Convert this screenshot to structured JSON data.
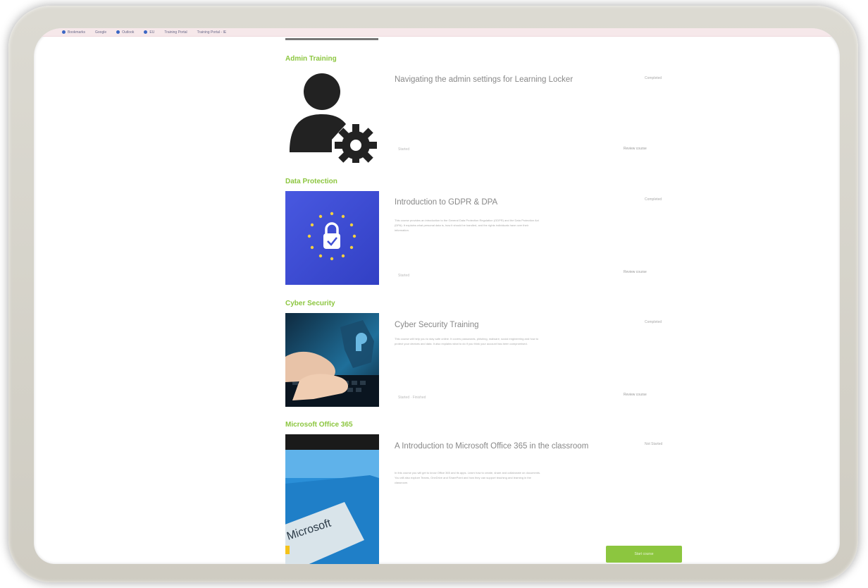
{
  "bookmarks": [
    "Bookmarks",
    "Google",
    "Outlook",
    "EU",
    "Training Portal",
    "Training Portal - IE"
  ],
  "sections": [
    {
      "category": "Admin Training",
      "course_title": "Navigating the admin settings for Learning Locker",
      "status": "Completed",
      "description": "",
      "meta": "Started",
      "action": "Review course",
      "thumb_icon": "user-gear-icon"
    },
    {
      "category": "Data Protection",
      "course_title": "Introduction to GDPR & DPA",
      "status": "Completed",
      "description": "This course provides an introduction to the General Data Protection Regulation (GDPR) and the Data Protection Act (DPA). It explains what personal data is, how it should be handled, and the rights individuals have over their information.",
      "meta": "Started",
      "action": "Review course",
      "thumb_icon": "eu-lock-icon",
      "thumb_color": "#3f4fd4"
    },
    {
      "category": "Cyber Security",
      "course_title": "Cyber Security Training",
      "status": "Completed",
      "description": "This course will help you to stay safe online. It covers passwords, phishing, malware, social engineering and how to protect your devices and data. It also explains what to do if you think your account has been compromised.",
      "meta": "Started · Finished",
      "action": "Review course",
      "thumb_icon": "hands-keyboard-icon"
    },
    {
      "category": "Microsoft Office 365",
      "course_title": "A Introduction to Microsoft Office 365 in the classroom",
      "status": "Not Started",
      "description": "In this course you will get to know Office 365 and its apps. Learn how to create, share and collaborate on documents. You will also explore Teams, OneDrive and SharePoint and how they can support teaching and learning in the classroom.",
      "action": "Start course",
      "thumb_icon": "microsoft-logo-icon"
    }
  ],
  "colors": {
    "accent": "#8cc63f",
    "gdpr_blue": "#3f4fd4"
  }
}
